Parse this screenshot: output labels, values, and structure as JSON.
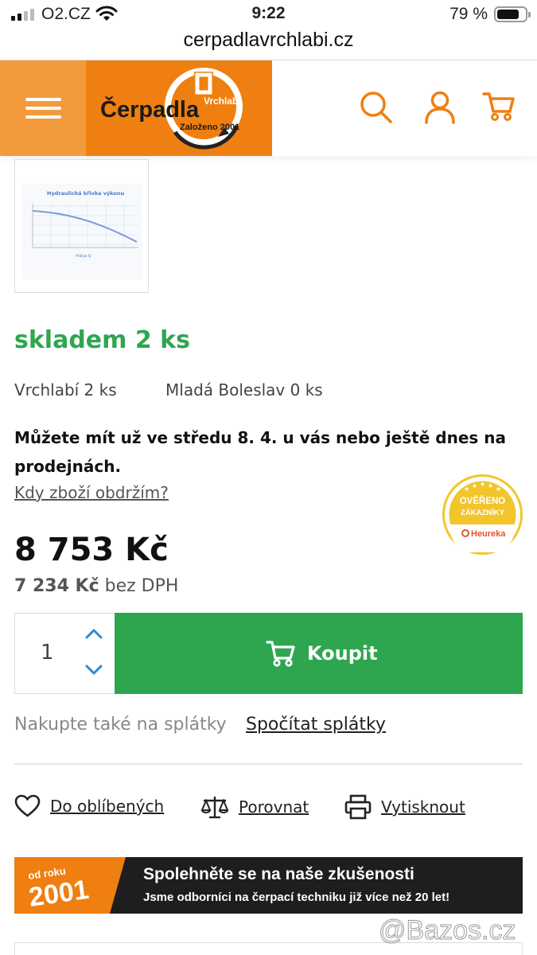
{
  "status_bar": {
    "carrier": "O2.CZ",
    "time": "9:22",
    "battery": "79 %"
  },
  "browser": {
    "url": "cerpadlavrchlabi.cz"
  },
  "header": {
    "logo": {
      "name": "Čerpadla",
      "sub": "Vrchlabí",
      "tagline": "Založeno 2001"
    },
    "icons": [
      "menu-icon",
      "search-icon",
      "user-icon",
      "cart-icon"
    ]
  },
  "gallery": {
    "thumbnail_title": "Hydraulická křivka výkonu",
    "thumbnail_xlabel": "Průtok Q"
  },
  "availability": {
    "stock": "skladem 2 ks",
    "branches": [
      "Vrchlabí 2 ks",
      "Mladá Boleslav 0 ks"
    ],
    "delivery": "Můžete mít už ve středu 8. 4. u vás nebo ještě dnes na prodejnách.",
    "delivery_link": "Kdy zboží obdržím?"
  },
  "badge": {
    "line1": "OVĚŘENO",
    "line2": "ZÁKAZNÍKY",
    "brand": "Heureka"
  },
  "price": {
    "with_vat": "8 753 Kč",
    "without_vat": "7 234 Kč",
    "without_vat_suffix": " bez DPH"
  },
  "purchase": {
    "quantity": "1",
    "buy_label": "Koupit"
  },
  "installments": {
    "text": "Nakupte také na splátky",
    "link": "Spočítat splátky"
  },
  "actions": [
    {
      "label": "Do oblíbených",
      "icon": "heart-icon"
    },
    {
      "label": "Porovnat",
      "icon": "scales-icon"
    },
    {
      "label": "Vytisknout",
      "icon": "printer-icon"
    }
  ],
  "banner": {
    "tag_line1": "od roku",
    "tag_line2": "2001",
    "title": "Spolehněte se na naše zkušenosti",
    "subtitle": "Jsme odborníci na čerpací techniku již více než 20 let!"
  },
  "watermark": "@Bazos.cz",
  "colors": {
    "orange": "#ef7f10",
    "orange_light": "#f39b3c",
    "green": "#2ea650",
    "dark": "#1e1e1e"
  }
}
